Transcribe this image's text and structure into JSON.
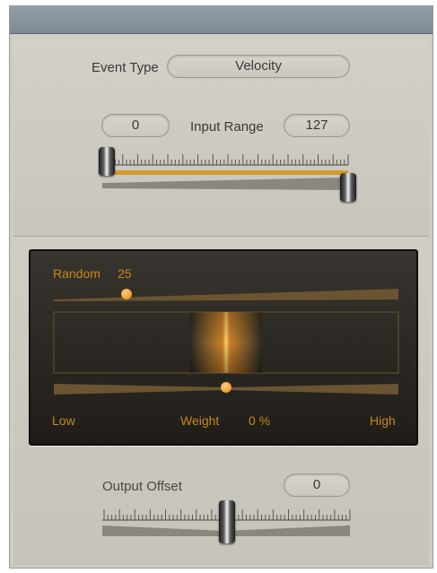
{
  "event_type": {
    "label": "Event Type",
    "value": "Velocity"
  },
  "input_range": {
    "label": "Input Range",
    "min": "0",
    "max": "127",
    "min_value": 0,
    "max_value": 127
  },
  "random": {
    "label": "Random",
    "value": "25",
    "fraction": 0.25
  },
  "weight": {
    "low_label": "Low",
    "high_label": "High",
    "label": "Weight",
    "value": "0 %",
    "fraction": 0.5
  },
  "output_offset": {
    "label": "Output Offset",
    "value": "0",
    "fraction": 0.5
  },
  "colors": {
    "accent": "#f0a23a",
    "panel_bg": "#cfccc4",
    "dark_panel": "#2a2622"
  }
}
